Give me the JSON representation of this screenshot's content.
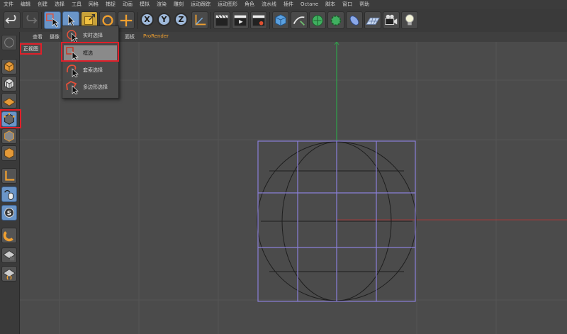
{
  "menubar": {
    "items": [
      "文件",
      "编辑",
      "创建",
      "选择",
      "工具",
      "网格",
      "捕捉",
      "动画",
      "模拟",
      "渲染",
      "雕刻",
      "运动跟踪",
      "运动图形",
      "角色",
      "流水线",
      "插件",
      "Octane",
      "脚本",
      "窗口",
      "帮助"
    ]
  },
  "toolbar": {
    "axis_x": "X",
    "axis_y": "Y",
    "axis_z": "Z"
  },
  "viewport_menu": {
    "items": [
      "查看",
      "摄像",
      "面板",
      "ProRender"
    ]
  },
  "viewport": {
    "label": "正视图"
  },
  "selection_menu": {
    "items": [
      {
        "label": "实时选择",
        "icon": "live-selection-icon"
      },
      {
        "label": "框选",
        "icon": "rectangle-selection-icon",
        "selected": true
      },
      {
        "label": "套索选择",
        "icon": "lasso-selection-icon"
      },
      {
        "label": "多边形选择",
        "icon": "polygon-selection-icon"
      }
    ]
  },
  "colors": {
    "highlight": "#e0202a",
    "grid": "#565656",
    "cage": "#8a7fd8",
    "y_axis": "#2fa34a",
    "x_axis": "#a33a3a"
  }
}
